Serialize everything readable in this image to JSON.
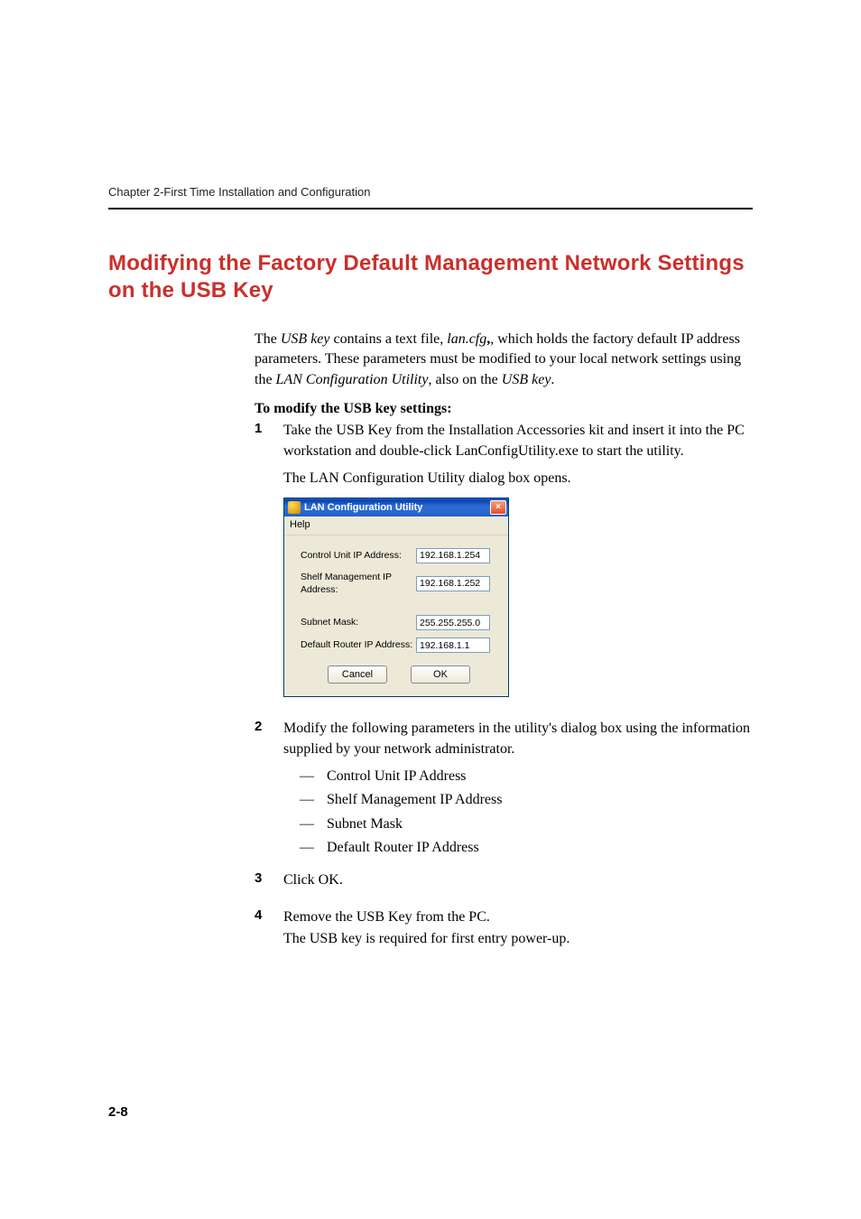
{
  "chapter_header": "Chapter 2-First Time Installation and Configuration",
  "section_title": "Modifying the Factory Default Management Network Settings on the USB Key",
  "intro": {
    "pre1": "The ",
    "usb_key": "USB key",
    "post1": " contains a text file, ",
    "lan_cfg": "lan.cfg",
    "post2": ", which holds the factory default IP address parameters. These parameters must be modified to your local network settings using the ",
    "util_name": "LAN Configuration Utility",
    "post3": ", also on the ",
    "usb_key2": "USB key",
    "post4": "."
  },
  "subhead": "To modify the USB key settings:",
  "steps": {
    "s1": {
      "num": "1",
      "pre": "Take the ",
      "usb_key": "USB Key",
      "mid1": " from the ",
      "kit": "Installation Accessories",
      "mid2": " kit and insert it into the PC workstation and double-click ",
      "exe": "LanConfigUtility.exe",
      "post": " to start the utility.",
      "line2a": "The ",
      "line2b": "LAN Configuration Utility",
      "line2c": " dialog box opens."
    },
    "s2": {
      "num": "2",
      "text": "Modify the following parameters in the utility's dialog box using the information supplied by your network administrator.",
      "items": {
        "a": "Control Unit IP Address",
        "b": "Shelf Management IP Address",
        "c": "Subnet Mask",
        "d": "Default Router IP Address"
      }
    },
    "s3": {
      "num": "3",
      "pre": "Click ",
      "ok": "OK",
      "post": "."
    },
    "s4": {
      "num": "4",
      "pre": "Remove the ",
      "usb_key": "USB Key",
      "post": " from the PC.",
      "line2": "The USB key is required for first entry power-up."
    }
  },
  "dialog": {
    "title": "LAN Configuration Utility",
    "close_x": "×",
    "menu_help": "Help",
    "fields": {
      "control_label": "Control Unit IP Address:",
      "control_value": "192.168.1.254",
      "shelf_label": "Shelf Management IP Address:",
      "shelf_value": "192.168.1.252",
      "subnet_label": "Subnet Mask:",
      "subnet_value": "255.255.255.0",
      "router_label": "Default Router IP Address:",
      "router_value": "192.168.1.1"
    },
    "buttons": {
      "cancel": "Cancel",
      "ok": "OK"
    }
  },
  "page_num": "2-8"
}
